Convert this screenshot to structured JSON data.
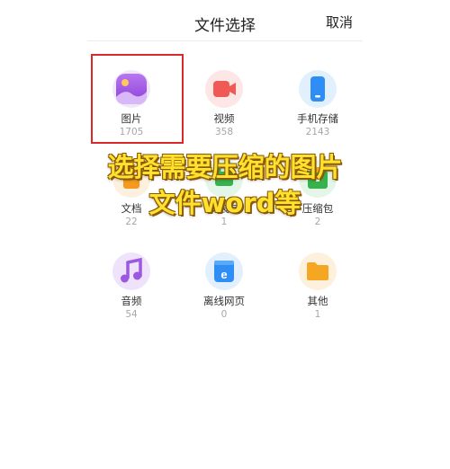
{
  "header": {
    "title": "文件选择",
    "cancel_label": "取消"
  },
  "categories": [
    {
      "label": "图片",
      "count": "1705",
      "icon": "image-icon",
      "color": "#a35ce0"
    },
    {
      "label": "视频",
      "count": "358",
      "icon": "video-icon",
      "color": "#f05a55"
    },
    {
      "label": "手机存储",
      "count": "2143",
      "icon": "phone-storage-icon",
      "color": "#2f8ef5"
    },
    {
      "label": "文档",
      "count": "22",
      "icon": "document-icon",
      "color": "#f59a1f"
    },
    {
      "label": "安装包",
      "count": "1",
      "icon": "app-package-icon",
      "color": "#37b24d"
    },
    {
      "label": "压缩包",
      "count": "2",
      "icon": "zip-icon",
      "color": "#37b24d"
    },
    {
      "label": "音频",
      "count": "54",
      "icon": "music-icon",
      "color": "#9b59e0"
    },
    {
      "label": "离线网页",
      "count": "0",
      "icon": "web-page-icon",
      "color": "#2f8ef5"
    },
    {
      "label": "其他",
      "count": "1",
      "icon": "folder-icon",
      "color": "#f5a623"
    }
  ],
  "overlay": {
    "line1": "选择需要压缩的图片",
    "line2": "文件word等"
  }
}
